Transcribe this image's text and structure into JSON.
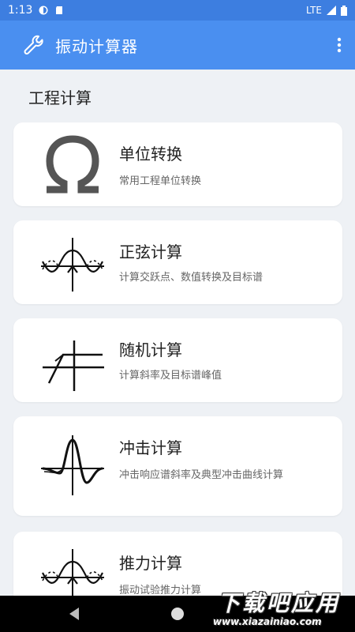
{
  "status_bar": {
    "time": "1:13",
    "network": "LTE"
  },
  "app_bar": {
    "title": "振动计算器",
    "logo_icon": "wrench-icon",
    "menu_icon": "more-vert-icon"
  },
  "section": {
    "title": "工程计算"
  },
  "cards": [
    {
      "title": "单位转换",
      "desc": "常用工程单位转换",
      "icon": "omega-icon"
    },
    {
      "title": "正弦计算",
      "desc": "计算交跃点、数值转换及目标谱",
      "icon": "sine-wave-icon"
    },
    {
      "title": "随机计算",
      "desc": "计算斜率及目标谱峰值",
      "icon": "random-spectrum-icon"
    },
    {
      "title": "冲击计算",
      "desc": "冲击响应谱斜率及典型冲击曲线计算",
      "icon": "shock-pulse-icon"
    },
    {
      "title": "推力计算",
      "desc": "振动试验推力计算",
      "icon": "sine-wave-icon"
    }
  ],
  "watermark": {
    "top": "下载吧应用",
    "bottom": "www.xiazainiao.com"
  }
}
